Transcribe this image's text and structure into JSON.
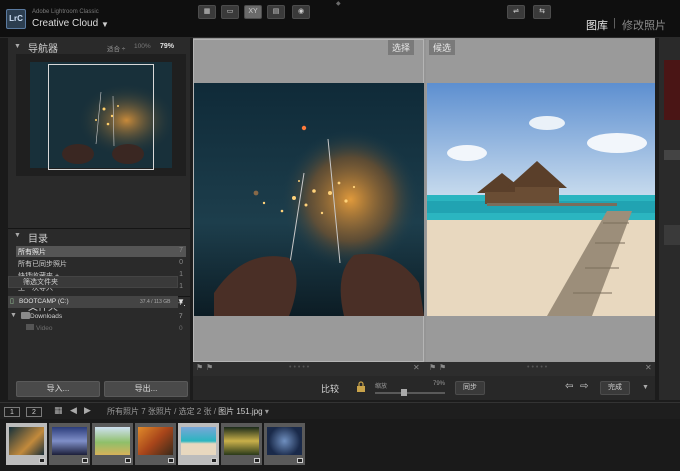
{
  "identity": {
    "app_name": "Adobe Lightroom Classic",
    "brand": "Creative Cloud",
    "logo": "LrC",
    "modules": [
      "图库",
      "修改照片"
    ],
    "module_sep": "|"
  },
  "navigator": {
    "title": "导航器",
    "fit": "适合 ÷",
    "zoom_100": "100%",
    "zoom_79": "79%"
  },
  "catalog": {
    "title": "目录",
    "items": [
      {
        "label": "所有照片",
        "count": "7"
      },
      {
        "label": "所有已同步照片",
        "count": "0"
      },
      {
        "label": "快捷收藏夹 +",
        "count": "1"
      },
      {
        "label": "上一次导入",
        "count": "1"
      }
    ]
  },
  "folders": {
    "title": "文件夹",
    "add": "+.",
    "filter": "筛选文件夹",
    "volume": "BOOTCAMP (C:)",
    "volume_size": "37.4 / 113 GB",
    "downloads": {
      "label": "Downloads",
      "count": "7"
    },
    "video": {
      "label": "Video",
      "count": "0"
    }
  },
  "buttons": {
    "import": "导入...",
    "export": "导出..."
  },
  "compare": {
    "select_label": "选择",
    "candidate_label": "候选"
  },
  "toolbar": {
    "compare": "比较",
    "zoom_label": "缩放",
    "zoom_pct": "79%",
    "sync": "同步",
    "done": "完成"
  },
  "filmstrip": {
    "page1": "1",
    "page2": "2",
    "crumb_all": "所有照片",
    "crumb_info": "7 张照片 / 选定 2 张 / ",
    "crumb_file": "图片 151.jpg",
    "crumb_caret": "▾",
    "thumbs": 7,
    "selected_indices": [
      0,
      4
    ]
  },
  "icons": [
    "search-icon",
    "lock-icon",
    "folder-icon",
    "drive-icon",
    "grid-view-icon",
    "loupe-view-icon",
    "compare-view-icon",
    "survey-view-icon",
    "people-view-icon",
    "arrow-left-icon",
    "arrow-right-icon"
  ]
}
